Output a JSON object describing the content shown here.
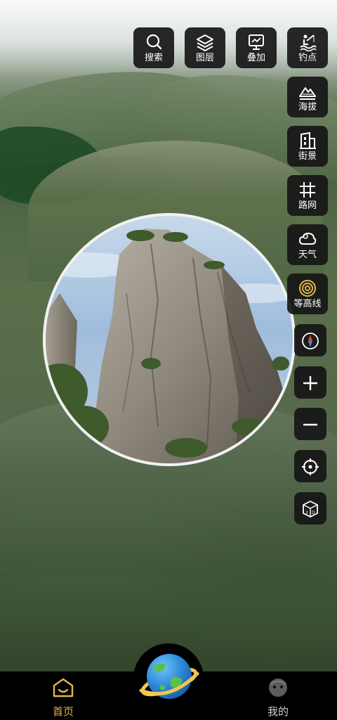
{
  "toolbar_top": [
    {
      "key": "search",
      "label": "搜索",
      "icon": "search-icon"
    },
    {
      "key": "layers",
      "label": "图层",
      "icon": "layers-icon"
    },
    {
      "key": "overlay",
      "label": "叠加",
      "icon": "overlay-chart-icon"
    },
    {
      "key": "fishing",
      "label": "钓点",
      "icon": "fishing-spot-icon"
    }
  ],
  "toolbar_side": [
    {
      "key": "elevation",
      "label": "海拔",
      "icon": "elevation-icon"
    },
    {
      "key": "streetview",
      "label": "街景",
      "icon": "street-view-icon"
    },
    {
      "key": "roadnet",
      "label": "路网",
      "icon": "road-network-icon"
    },
    {
      "key": "weather",
      "label": "天气",
      "icon": "weather-icon"
    },
    {
      "key": "contour",
      "label": "等高线",
      "icon": "contour-icon",
      "accent": "#e1b64a"
    }
  ],
  "map_controls": [
    {
      "key": "compass",
      "icon": "compass-icon"
    },
    {
      "key": "zoom_in",
      "icon": "zoom-in-icon"
    },
    {
      "key": "zoom_out",
      "icon": "zoom-out-icon"
    },
    {
      "key": "locate",
      "icon": "locate-icon"
    },
    {
      "key": "view3d",
      "icon": "3d-view-icon"
    }
  ],
  "bottom_nav": {
    "home_label": "首页",
    "mine_label": "我的",
    "center_icon": "planet-icon"
  },
  "colors": {
    "accent": "#e1b64a",
    "button_bg": "#161616",
    "nav_bg": "#000000"
  }
}
